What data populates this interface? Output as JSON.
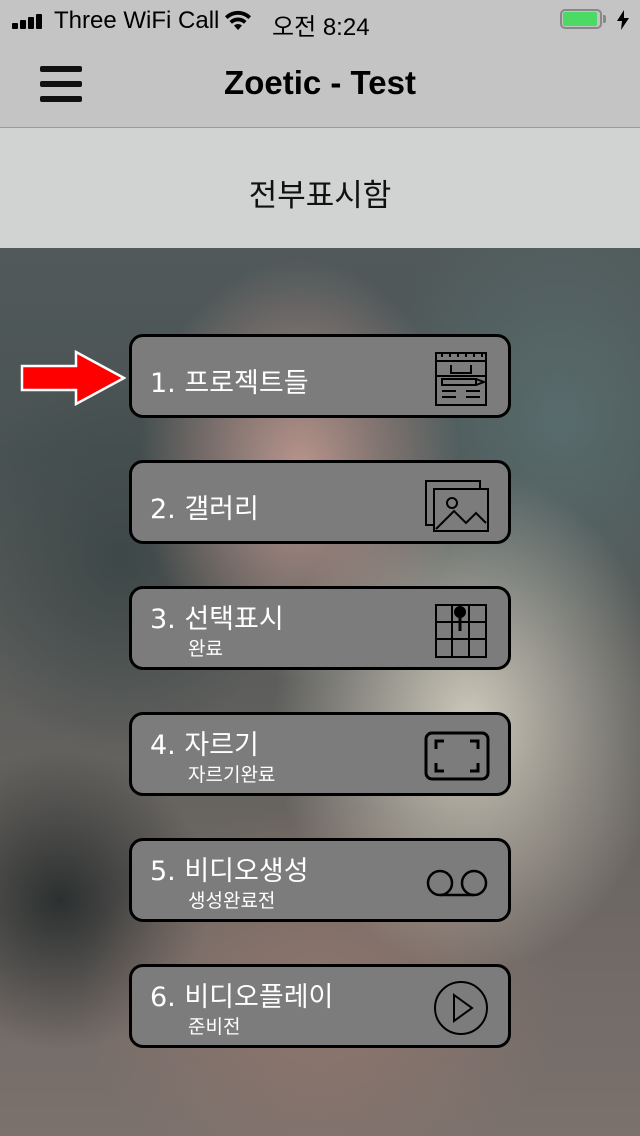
{
  "status_bar": {
    "carrier": "Three WiFi Call",
    "time": "오전 8:24",
    "battery_color": "#4cd964"
  },
  "nav": {
    "title": "Zoetic - Test",
    "menu_icon": "hamburger-menu-icon"
  },
  "header": {
    "title": "전부표시함"
  },
  "menu": [
    {
      "title": "1. 프로젝트들",
      "subtitle": "",
      "icon": "project-board-icon"
    },
    {
      "title": "2. 갤러리",
      "subtitle": "",
      "icon": "gallery-icon"
    },
    {
      "title": "3. 선택표시",
      "subtitle": "완료",
      "icon": "grid-pin-icon"
    },
    {
      "title": "4. 자르기",
      "subtitle": "자르기완료",
      "icon": "crop-frame-icon"
    },
    {
      "title": "5. 비디오생성",
      "subtitle": "생성완료전",
      "icon": "tape-reels-icon"
    },
    {
      "title": "6. 비디오플레이",
      "subtitle": "준비전",
      "icon": "play-circle-icon"
    }
  ],
  "annotation": {
    "icon": "red-arrow-icon",
    "color": "#ff0000"
  }
}
